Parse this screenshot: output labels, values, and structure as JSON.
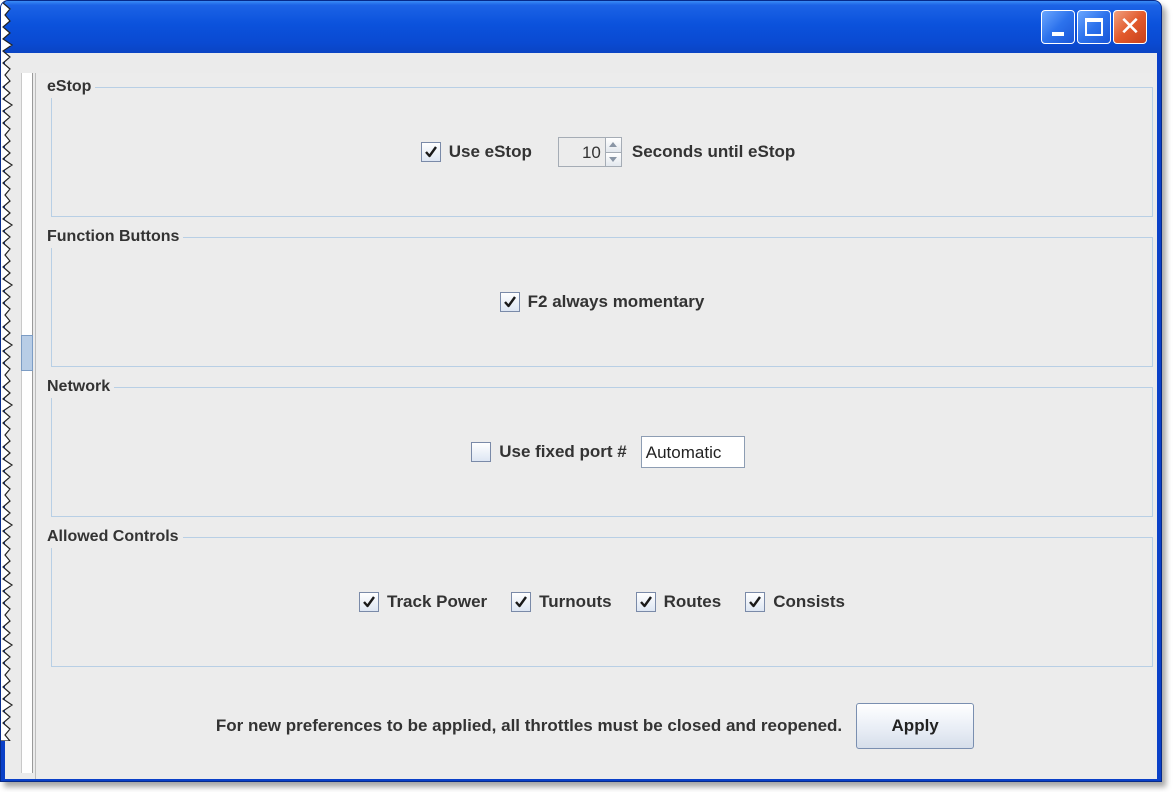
{
  "window": {
    "controls": {
      "minimize_icon": "minimize-icon",
      "maximize_icon": "maximize-icon",
      "close_icon": "close-icon",
      "close_glyph": "✕"
    }
  },
  "estop": {
    "title": "eStop",
    "use_estop_label": "Use eStop",
    "use_estop_checked": true,
    "seconds_value": "10",
    "seconds_label": "Seconds until eStop"
  },
  "function_buttons": {
    "title": "Function Buttons",
    "f2_label": "F2 always momentary",
    "f2_checked": true
  },
  "network": {
    "title": "Network",
    "fixed_port_label": "Use fixed port #",
    "fixed_port_checked": false,
    "port_value": "Automatic"
  },
  "allowed_controls": {
    "title": "Allowed Controls",
    "items": [
      {
        "label": "Track Power",
        "checked": true
      },
      {
        "label": "Turnouts",
        "checked": true
      },
      {
        "label": "Routes",
        "checked": true
      },
      {
        "label": "Consists",
        "checked": true
      }
    ]
  },
  "footer": {
    "notice": "For new preferences to be applied, all throttles must be closed and reopened.",
    "apply_label": "Apply"
  },
  "colors": {
    "titlebar": "#0b52dc",
    "panel_bg": "#ececec",
    "group_border": "#b8cfe5",
    "close_button": "#e25a2c"
  }
}
